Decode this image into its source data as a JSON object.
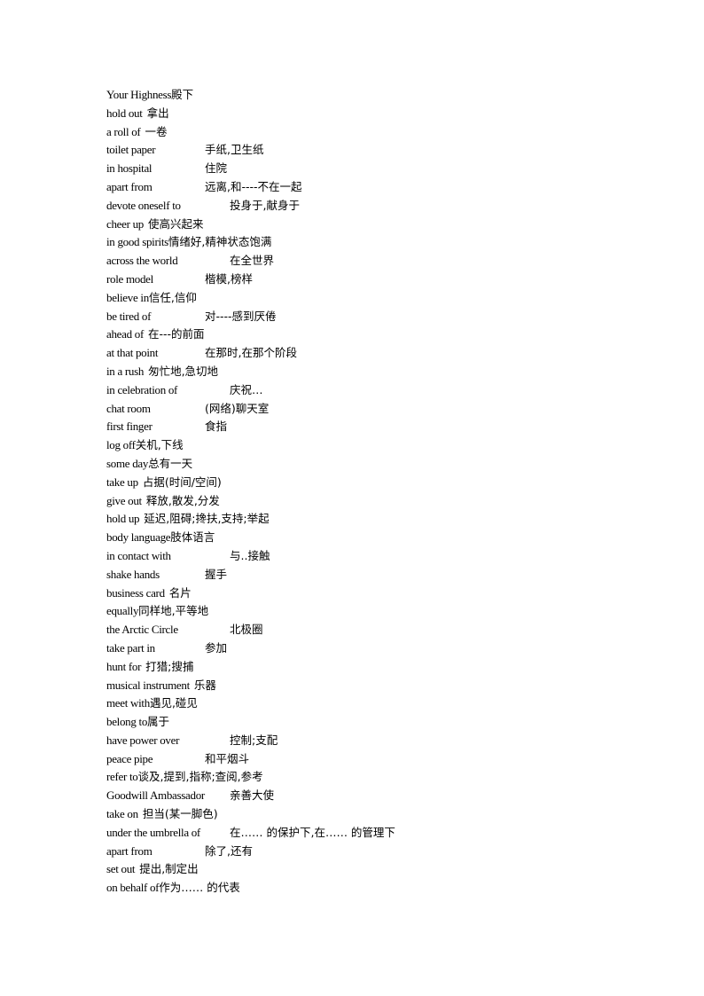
{
  "document": {
    "entries": [
      {
        "term": "Your Highness",
        "gloss": "殿下"
      },
      {
        "term": "hold out",
        "gloss": "拿出"
      },
      {
        "term": "a roll of",
        "gloss": "一卷"
      },
      {
        "term": "toilet paper",
        "gloss": "手纸,卫生纸"
      },
      {
        "term": "in hospital",
        "gloss": "住院"
      },
      {
        "term": "apart from",
        "gloss": "远离,和----不在一起"
      },
      {
        "term": "devote oneself to",
        "gloss": "投身于,献身于"
      },
      {
        "term": "cheer up",
        "gloss": "使高兴起来"
      },
      {
        "term": "in good spirits",
        "gloss": "情绪好,精神状态饱满"
      },
      {
        "term": "across the world",
        "gloss": "在全世界"
      },
      {
        "term": "role model",
        "gloss": "楷模,榜样"
      },
      {
        "term": "believe in",
        "gloss": "信任,信仰"
      },
      {
        "term": "be tired of",
        "gloss": "对----感到厌倦"
      },
      {
        "term": "ahead of",
        "gloss": "在---的前面"
      },
      {
        "term": "at that point",
        "gloss": "在那时,在那个阶段"
      },
      {
        "term": "in a rush",
        "gloss": "匆忙地,急切地"
      },
      {
        "term": "in celebration of",
        "gloss": "庆祝…"
      },
      {
        "term": "chat room",
        "gloss": "(网络)聊天室"
      },
      {
        "term": "first finger",
        "gloss": "食指"
      },
      {
        "term": "log off",
        "gloss": "关机,下线"
      },
      {
        "term": "some day",
        "gloss": "总有一天"
      },
      {
        "term": "take up",
        "gloss": "占据(时间/空间)"
      },
      {
        "term": "give out",
        "gloss": "释放,散发,分发"
      },
      {
        "term": "hold up",
        "gloss": "延迟,阻碍;搀扶,支持;举起"
      },
      {
        "term": "body language",
        "gloss": "肢体语言"
      },
      {
        "term": "in contact with",
        "gloss": "与..接触"
      },
      {
        "term": "shake hands",
        "gloss": "握手"
      },
      {
        "term": "business card",
        "gloss": "名片"
      },
      {
        "term": "equally",
        "gloss": "同样地,平等地"
      },
      {
        "term": "the Arctic Circle",
        "gloss": "北极圈"
      },
      {
        "term": "take part in",
        "gloss": "参加"
      },
      {
        "term": "hunt for",
        "gloss": "打猎;搜捕"
      },
      {
        "term": "musical instrument",
        "gloss": "乐器"
      },
      {
        "term": "meet with",
        "gloss": "遇见,碰见"
      },
      {
        "term": "belong to",
        "gloss": "属于"
      },
      {
        "term": "have power over",
        "gloss": "控制;支配"
      },
      {
        "term": "peace pipe",
        "gloss": "和平烟斗"
      },
      {
        "term": "refer to",
        "gloss": "谈及,提到,指称;查阅,参考"
      },
      {
        "term": "Goodwill Ambassador",
        "gloss": "亲善大使"
      },
      {
        "term": "take on",
        "gloss": "担当(某一脚色)"
      },
      {
        "term": "under the umbrella of",
        "gloss": "在…… 的保护下,在…… 的管理下"
      },
      {
        "term": "apart from",
        "gloss": "除了,还有"
      },
      {
        "term": "set out",
        "gloss": "提出,制定出"
      },
      {
        "term": "on behalf of",
        "gloss": "作为…… 的代表"
      }
    ]
  }
}
